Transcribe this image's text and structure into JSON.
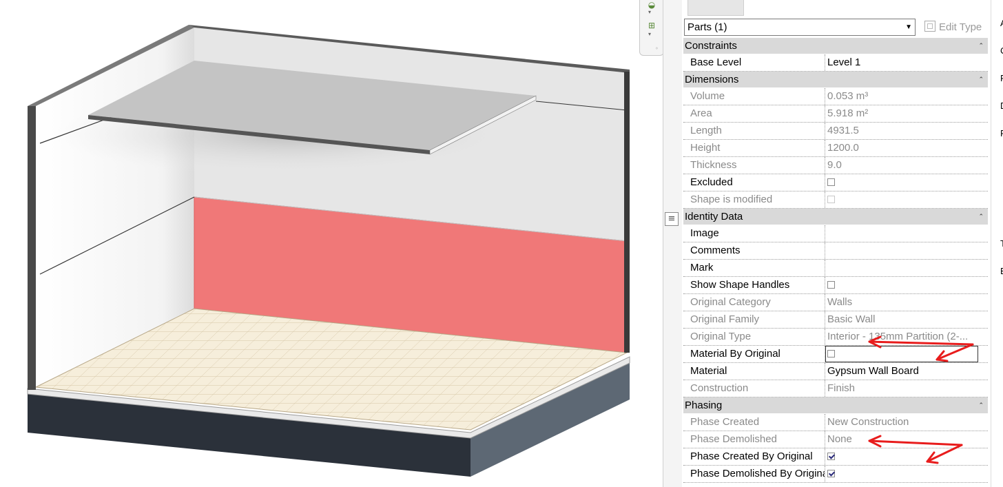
{
  "palette": {
    "accent_wall": "#f07878",
    "floor_tile": "#f5ecd7",
    "base_dark": "#2b313a",
    "annotation_red": "#e81c1c",
    "group_header_bg": "#d9d9d9"
  },
  "navbar": {
    "icons": [
      "orbit-icon",
      "zoom-region-icon"
    ]
  },
  "properties": {
    "selector": {
      "value": "Parts (1)"
    },
    "edit_type_label": "Edit Type",
    "groups": [
      {
        "label": "Constraints",
        "rows": [
          {
            "name": "Base Level",
            "value": "Level 1",
            "readonly": false
          }
        ]
      },
      {
        "label": "Dimensions",
        "rows": [
          {
            "name": "Volume",
            "value": "0.053 m³",
            "readonly": true
          },
          {
            "name": "Area",
            "value": "5.918 m²",
            "readonly": true
          },
          {
            "name": "Length",
            "value": "4931.5",
            "readonly": true
          },
          {
            "name": "Height",
            "value": "1200.0",
            "readonly": true
          },
          {
            "name": "Thickness",
            "value": "9.0",
            "readonly": true
          },
          {
            "name": "Excluded",
            "checkbox": true,
            "checked": false,
            "readonly": false
          },
          {
            "name": "Shape is modified",
            "checkbox": true,
            "checked": false,
            "readonly": true
          }
        ]
      },
      {
        "label": "Identity Data",
        "rows": [
          {
            "name": "Image",
            "value": "",
            "readonly": false
          },
          {
            "name": "Comments",
            "value": "",
            "readonly": false
          },
          {
            "name": "Mark",
            "value": "",
            "readonly": false
          },
          {
            "name": "Show Shape Handles",
            "checkbox": true,
            "checked": false,
            "readonly": false
          },
          {
            "name": "Original Category",
            "value": "Walls",
            "readonly": true
          },
          {
            "name": "Original Family",
            "value": "Basic Wall",
            "readonly": true
          },
          {
            "name": "Original Type",
            "value": "Interior - 135mm Partition (2-...",
            "readonly": true
          },
          {
            "name": "Material By Original",
            "checkbox": true,
            "checked": false,
            "readonly": false,
            "selected": true
          },
          {
            "name": "Material",
            "value": "Gypsum Wall Board",
            "readonly": false
          },
          {
            "name": "Construction",
            "value": "Finish",
            "readonly": true
          }
        ]
      },
      {
        "label": "Phasing",
        "rows": [
          {
            "name": "Phase Created",
            "value": "New Construction",
            "readonly": true
          },
          {
            "name": "Phase Demolished",
            "value": "None",
            "readonly": true
          },
          {
            "name": "Phase Created By Original",
            "checkbox": true,
            "checked": true,
            "readonly": false
          },
          {
            "name": "Phase Demolished By Original",
            "checkbox": true,
            "checked": true,
            "readonly": false
          }
        ]
      }
    ]
  },
  "right_edge_glyphs": [
    "A",
    "C",
    "F",
    "D",
    "F",
    "T",
    "E"
  ]
}
